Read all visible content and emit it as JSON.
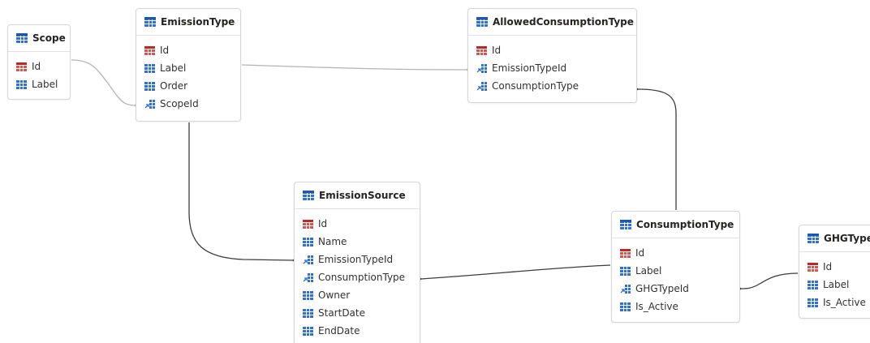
{
  "tables": [
    {
      "id": "scope",
      "name": "Scope",
      "fields": [
        {
          "label": "Id",
          "icon": "key-icon"
        },
        {
          "label": "Label",
          "icon": "column-icon"
        }
      ]
    },
    {
      "id": "emissiontype",
      "name": "EmissionType",
      "fields": [
        {
          "label": "Id",
          "icon": "key-icon"
        },
        {
          "label": "Label",
          "icon": "column-icon"
        },
        {
          "label": "Order",
          "icon": "column-icon"
        },
        {
          "label": "ScopeId",
          "icon": "foreign-key-icon"
        }
      ]
    },
    {
      "id": "allowedconsumptiontype",
      "name": "AllowedConsumptionType",
      "fields": [
        {
          "label": "Id",
          "icon": "key-icon"
        },
        {
          "label": "EmissionTypeId",
          "icon": "foreign-key-icon"
        },
        {
          "label": "ConsumptionType",
          "icon": "foreign-key-icon"
        }
      ]
    },
    {
      "id": "emissionsource",
      "name": "EmissionSource",
      "fields": [
        {
          "label": "Id",
          "icon": "key-icon"
        },
        {
          "label": "Name",
          "icon": "column-icon"
        },
        {
          "label": "EmissionTypeId",
          "icon": "foreign-key-icon"
        },
        {
          "label": "ConsumptionType",
          "icon": "foreign-key-icon"
        },
        {
          "label": "Owner",
          "icon": "column-icon"
        },
        {
          "label": "StartDate",
          "icon": "column-icon"
        },
        {
          "label": "EndDate",
          "icon": "column-icon"
        }
      ]
    },
    {
      "id": "consumptiontype",
      "name": "ConsumptionType",
      "fields": [
        {
          "label": "Id",
          "icon": "key-icon"
        },
        {
          "label": "Label",
          "icon": "column-icon"
        },
        {
          "label": "GHGTypeId",
          "icon": "foreign-key-icon"
        },
        {
          "label": "Is_Active",
          "icon": "column-icon"
        }
      ]
    },
    {
      "id": "ghgtype",
      "name": "GHGType",
      "fields": [
        {
          "label": "Id",
          "icon": "key-icon"
        },
        {
          "label": "Label",
          "icon": "column-icon"
        },
        {
          "label": "Is_Active",
          "icon": "column-icon"
        }
      ]
    }
  ],
  "relationships": [
    {
      "from": "scope",
      "to": "emissiontype"
    },
    {
      "from": "emissiontype",
      "to": "allowedconsumptiontype"
    },
    {
      "from": "emissiontype",
      "to": "emissionsource"
    },
    {
      "from": "consumptiontype",
      "to": "allowedconsumptiontype"
    },
    {
      "from": "consumptiontype",
      "to": "emissionsource"
    },
    {
      "from": "ghgtype",
      "to": "consumptiontype"
    }
  ],
  "colors": {
    "key": "#d9534f",
    "column": "#2f6fd6",
    "foreign_key": "#2f6fd6",
    "link_light": "#b4b4b4",
    "link_dark": "#3c3c3c",
    "text": "#323130"
  }
}
